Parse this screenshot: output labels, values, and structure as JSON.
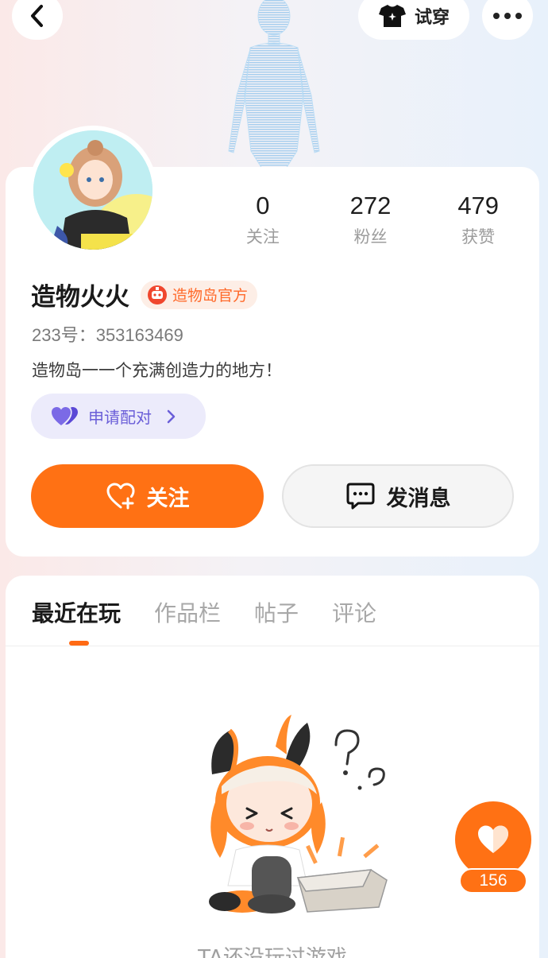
{
  "header": {
    "tryon_label": "试穿"
  },
  "profile": {
    "name": "造物火火",
    "badge_label": "造物岛官方",
    "uid_text": "233号：353163469",
    "bio": "造物岛一一个充满创造力的地方！",
    "pair_label": "申请配对",
    "stats": [
      {
        "value": "0",
        "label": "关注"
      },
      {
        "value": "272",
        "label": "粉丝"
      },
      {
        "value": "479",
        "label": "获赞"
      }
    ]
  },
  "actions": {
    "follow_label": "关注",
    "message_label": "发消息"
  },
  "tabs": [
    {
      "label": "最近在玩",
      "active": true
    },
    {
      "label": "作品栏",
      "active": false
    },
    {
      "label": "帖子",
      "active": false
    },
    {
      "label": "评论",
      "active": false
    }
  ],
  "empty_state": {
    "text": "TA还没玩过游戏"
  },
  "like_fab": {
    "count": "156"
  },
  "colors": {
    "accent": "#ff7114",
    "badge_text": "#ff6a2b",
    "pair_text": "#6a5ed8"
  }
}
